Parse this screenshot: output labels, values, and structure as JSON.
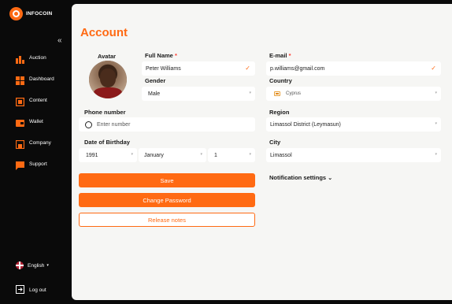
{
  "sidebar": {
    "brand": "INFOCOIN",
    "collapse_icon": "«",
    "items": [
      {
        "label": "Auction",
        "icon": "bar-chart-icon"
      },
      {
        "label": "Dashboard",
        "icon": "grid-icon"
      },
      {
        "label": "Content",
        "icon": "content-icon"
      },
      {
        "label": "Wallet",
        "icon": "wallet-icon"
      },
      {
        "label": "Company",
        "icon": "company-icon"
      },
      {
        "label": "Support",
        "icon": "chat-icon"
      }
    ],
    "language": "English",
    "logout": "Log out"
  },
  "page": {
    "title": "Account",
    "avatar_label": "Avatar",
    "full_name": {
      "label": "Full Name",
      "value": "Peter Williams"
    },
    "email": {
      "label": "E-mail",
      "value": "p.williams@gmail.com"
    },
    "gender": {
      "label": "Gender",
      "value": "Male"
    },
    "country": {
      "label": "Country",
      "value": "Cyprus"
    },
    "phone": {
      "label": "Phone number",
      "placeholder": "Enter number"
    },
    "region": {
      "label": "Region",
      "value": "Limassol District (Leymasun)"
    },
    "birthday": {
      "label": "Date of Birthday",
      "year": "1991",
      "month": "January",
      "day": "1"
    },
    "city": {
      "label": "City",
      "value": "Limassol"
    },
    "buttons": {
      "save": "Save",
      "change_password": "Change Password",
      "release_notes": "Release notes"
    },
    "notification_settings": "Notification settings"
  },
  "colors": {
    "accent": "#ff6a13",
    "sidebar_bg": "#0a0a0a",
    "main_bg": "#f6f6f4"
  }
}
